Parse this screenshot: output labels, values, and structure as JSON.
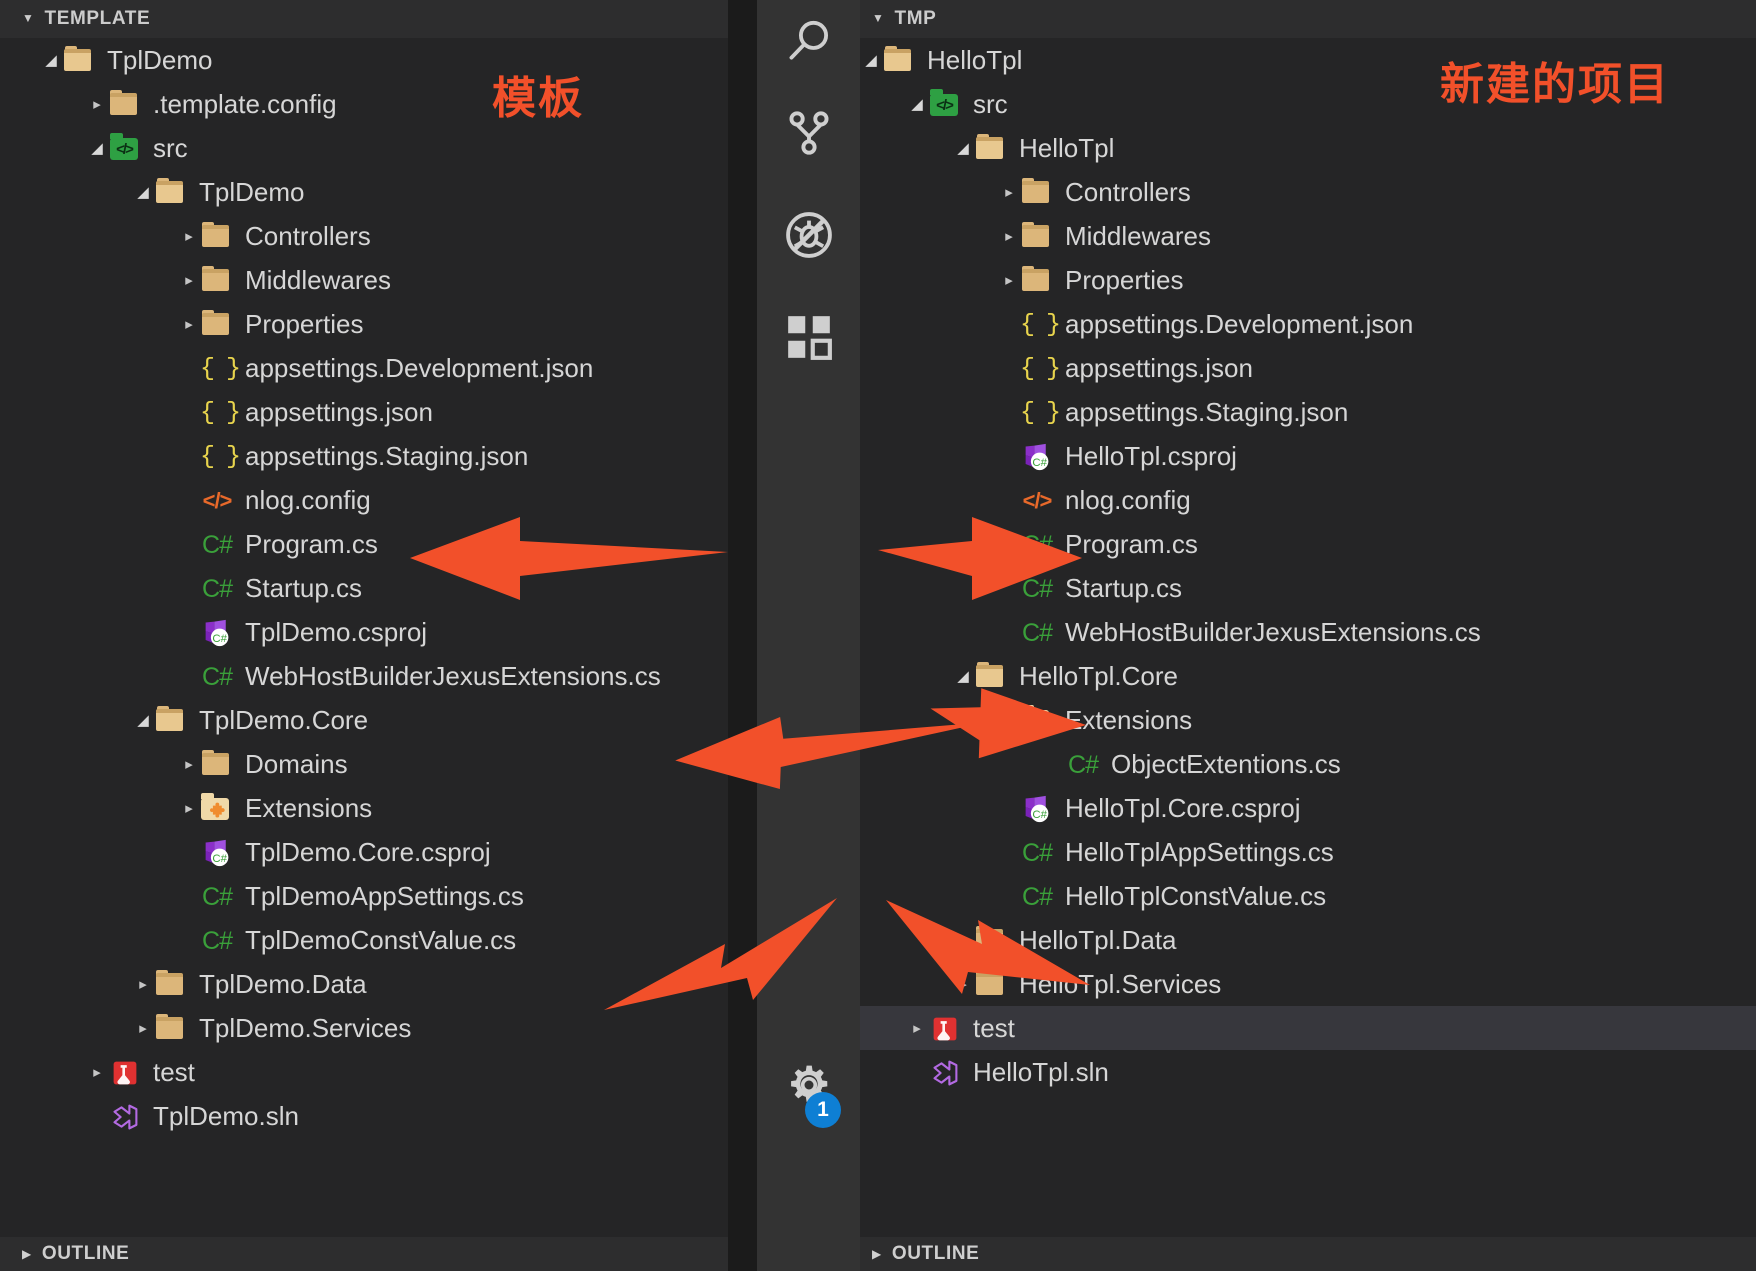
{
  "left_panel": {
    "header": "TEMPLATE",
    "outline": "OUTLINE",
    "annotation": "模板",
    "items": [
      {
        "label": "TplDemo",
        "icon": "folder-open-icon",
        "indent": 1,
        "state": "open"
      },
      {
        "label": ".template.config",
        "icon": "folder-icon",
        "indent": 2,
        "state": "closed"
      },
      {
        "label": "src",
        "icon": "folder-src-icon",
        "indent": 2,
        "state": "open"
      },
      {
        "label": "TplDemo",
        "icon": "folder-open-icon",
        "indent": 3,
        "state": "open"
      },
      {
        "label": "Controllers",
        "icon": "folder-icon",
        "indent": 4,
        "state": "closed"
      },
      {
        "label": "Middlewares",
        "icon": "folder-icon",
        "indent": 4,
        "state": "closed"
      },
      {
        "label": "Properties",
        "icon": "folder-icon",
        "indent": 4,
        "state": "closed"
      },
      {
        "label": "appsettings.Development.json",
        "icon": "json-icon",
        "indent": 4,
        "state": "leaf"
      },
      {
        "label": "appsettings.json",
        "icon": "json-icon",
        "indent": 4,
        "state": "leaf"
      },
      {
        "label": "appsettings.Staging.json",
        "icon": "json-icon",
        "indent": 4,
        "state": "leaf"
      },
      {
        "label": "nlog.config",
        "icon": "xml-icon",
        "indent": 4,
        "state": "leaf"
      },
      {
        "label": "Program.cs",
        "icon": "csharp-icon",
        "indent": 4,
        "state": "leaf"
      },
      {
        "label": "Startup.cs",
        "icon": "csharp-icon",
        "indent": 4,
        "state": "leaf"
      },
      {
        "label": "TplDemo.csproj",
        "icon": "csproj-icon",
        "indent": 4,
        "state": "leaf"
      },
      {
        "label": "WebHostBuilderJexusExtensions.cs",
        "icon": "csharp-icon",
        "indent": 4,
        "state": "leaf"
      },
      {
        "label": "TplDemo.Core",
        "icon": "folder-open-icon",
        "indent": 3,
        "state": "open"
      },
      {
        "label": "Domains",
        "icon": "folder-icon",
        "indent": 4,
        "state": "closed"
      },
      {
        "label": "Extensions",
        "icon": "folder-ext-icon",
        "indent": 4,
        "state": "closed"
      },
      {
        "label": "TplDemo.Core.csproj",
        "icon": "csproj-icon",
        "indent": 4,
        "state": "leaf"
      },
      {
        "label": "TplDemoAppSettings.cs",
        "icon": "csharp-icon",
        "indent": 4,
        "state": "leaf"
      },
      {
        "label": "TplDemoConstValue.cs",
        "icon": "csharp-icon",
        "indent": 4,
        "state": "leaf"
      },
      {
        "label": "TplDemo.Data",
        "icon": "folder-icon",
        "indent": 3,
        "state": "closed"
      },
      {
        "label": "TplDemo.Services",
        "icon": "folder-icon",
        "indent": 3,
        "state": "closed"
      },
      {
        "label": "test",
        "icon": "test-folder-icon",
        "indent": 2,
        "state": "closed"
      },
      {
        "label": "TplDemo.sln",
        "icon": "sln-icon",
        "indent": 2,
        "state": "leaf"
      }
    ]
  },
  "right_panel": {
    "header": "TMP",
    "outline": "OUTLINE",
    "annotation": "新建的项目",
    "items": [
      {
        "label": "HelloTpl",
        "icon": "folder-open-icon",
        "indent": 1,
        "state": "open"
      },
      {
        "label": "src",
        "icon": "folder-src-icon",
        "indent": 2,
        "state": "open"
      },
      {
        "label": "HelloTpl",
        "icon": "folder-open-icon",
        "indent": 3,
        "state": "open"
      },
      {
        "label": "Controllers",
        "icon": "folder-icon",
        "indent": 4,
        "state": "closed"
      },
      {
        "label": "Middlewares",
        "icon": "folder-icon",
        "indent": 4,
        "state": "closed"
      },
      {
        "label": "Properties",
        "icon": "folder-icon",
        "indent": 4,
        "state": "closed"
      },
      {
        "label": "appsettings.Development.json",
        "icon": "json-icon",
        "indent": 4,
        "state": "leaf"
      },
      {
        "label": "appsettings.json",
        "icon": "json-icon",
        "indent": 4,
        "state": "leaf"
      },
      {
        "label": "appsettings.Staging.json",
        "icon": "json-icon",
        "indent": 4,
        "state": "leaf"
      },
      {
        "label": "HelloTpl.csproj",
        "icon": "csproj-icon",
        "indent": 4,
        "state": "leaf"
      },
      {
        "label": "nlog.config",
        "icon": "xml-icon",
        "indent": 4,
        "state": "leaf"
      },
      {
        "label": "Program.cs",
        "icon": "csharp-icon",
        "indent": 4,
        "state": "leaf"
      },
      {
        "label": "Startup.cs",
        "icon": "csharp-icon",
        "indent": 4,
        "state": "leaf"
      },
      {
        "label": "WebHostBuilderJexusExtensions.cs",
        "icon": "csharp-icon",
        "indent": 4,
        "state": "leaf"
      },
      {
        "label": "HelloTpl.Core",
        "icon": "folder-open-icon",
        "indent": 3,
        "state": "open"
      },
      {
        "label": "Extensions",
        "icon": "folder-ext-icon",
        "indent": 4,
        "state": "open"
      },
      {
        "label": "ObjectExtentions.cs",
        "icon": "csharp-icon",
        "indent": 5,
        "state": "leaf"
      },
      {
        "label": "HelloTpl.Core.csproj",
        "icon": "csproj-icon",
        "indent": 4,
        "state": "leaf"
      },
      {
        "label": "HelloTplAppSettings.cs",
        "icon": "csharp-icon",
        "indent": 4,
        "state": "leaf"
      },
      {
        "label": "HelloTplConstValue.cs",
        "icon": "csharp-icon",
        "indent": 4,
        "state": "leaf"
      },
      {
        "label": "HelloTpl.Data",
        "icon": "folder-icon",
        "indent": 3,
        "state": "closed"
      },
      {
        "label": "HelloTpl.Services",
        "icon": "folder-icon",
        "indent": 3,
        "state": "closed"
      },
      {
        "label": "test",
        "icon": "test-folder-icon",
        "indent": 2,
        "state": "closed",
        "selected": true
      },
      {
        "label": "HelloTpl.sln",
        "icon": "sln-icon",
        "indent": 2,
        "state": "leaf"
      }
    ]
  },
  "activity_bar": {
    "items": [
      {
        "name": "search-icon"
      },
      {
        "name": "source-control-icon"
      },
      {
        "name": "debug-icon"
      },
      {
        "name": "extensions-icon"
      }
    ],
    "settings": {
      "name": "gear-icon",
      "badge": "1"
    }
  },
  "colors": {
    "annotation": "#f2502a",
    "arrow": "#f2502a",
    "folder": "#dcb67a",
    "json": "#e8d44d",
    "xml": "#e8692a",
    "csharp": "#3aa03a",
    "selection": "#37373d",
    "panel_bg": "#252526",
    "header_bg": "#2d2d2e",
    "activity_bg": "#333333",
    "badge": "#0e7fd4"
  }
}
